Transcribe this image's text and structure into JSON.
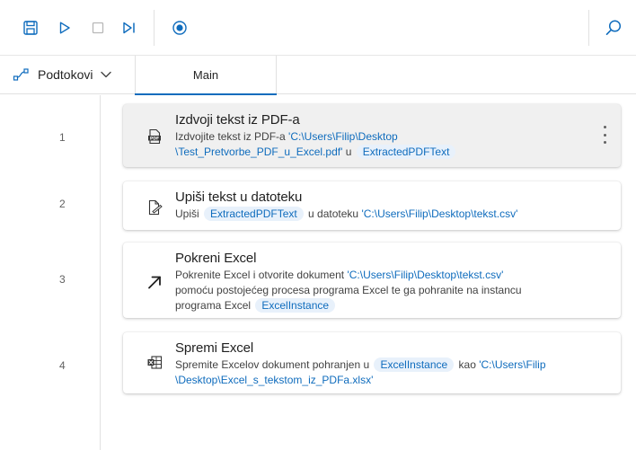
{
  "toolbar": {
    "save_icon": "save-icon",
    "run_icon": "play-icon",
    "stop_icon": "stop-icon",
    "step_icon": "step-forward-icon",
    "record_icon": "record-icon",
    "search_icon": "search-icon"
  },
  "tabs": {
    "subflows_label": "Podtokovi",
    "main_label": "Main"
  },
  "colors": {
    "accent": "#0f6cbd",
    "variable_bg": "#e8f1fb",
    "selected_card_bg": "#f0f0f0"
  },
  "actions": [
    {
      "line": "1",
      "title": "Izdvoji tekst iz PDF-a",
      "icon": "pdf-icon",
      "desc_1": "Izdvojite tekst iz PDF-a ",
      "path_1": "'C:\\Users\\Filip\\Desktop",
      "path_2": "\\Test_Pretvorbe_PDF_u_Excel.pdf'",
      "desc_2": " u ",
      "var_1": "ExtractedPDFText"
    },
    {
      "line": "2",
      "title": "Upiši tekst u datoteku",
      "icon": "write-file-icon",
      "desc_1": "Upiši ",
      "var_1": "ExtractedPDFText",
      "desc_2": " u datoteku ",
      "path_1": "'C:\\Users\\Filip\\Desktop\\tekst.csv'"
    },
    {
      "line": "3",
      "title": "Pokreni Excel",
      "icon": "launch-arrow-icon",
      "desc_1": "Pokrenite Excel i otvorite dokument ",
      "path_1": "'C:\\Users\\Filip\\Desktop\\tekst.csv'",
      "desc_2": "pomoću postojećeg procesa programa Excel te ga pohranite na instancu",
      "desc_3": "programa Excel ",
      "var_1": "ExcelInstance"
    },
    {
      "line": "4",
      "title": "Spremi Excel",
      "icon": "excel-save-icon",
      "desc_1": "Spremite Excelov dokument pohranjen u ",
      "var_1": "ExcelInstance",
      "desc_2": " kao ",
      "path_1": "'C:\\Users\\Filip",
      "path_2": "\\Desktop\\Excel_s_tekstom_iz_PDFa.xlsx'"
    }
  ]
}
